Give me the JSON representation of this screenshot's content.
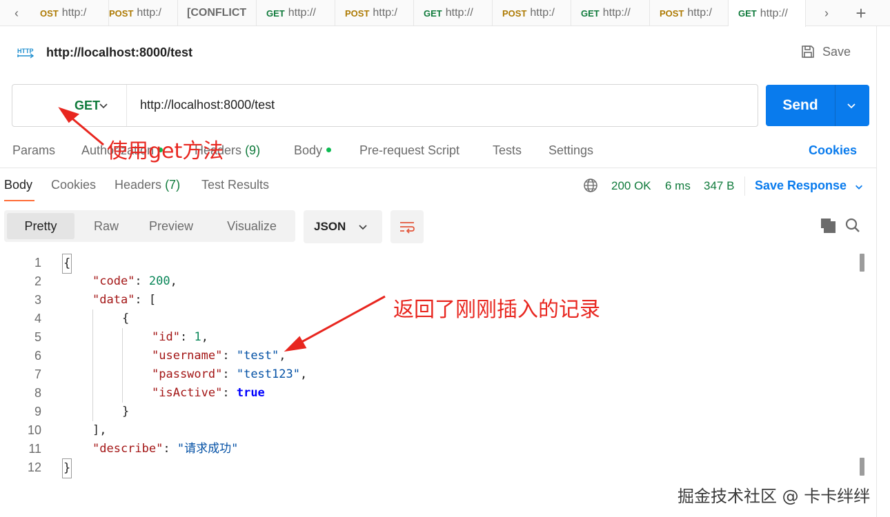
{
  "tabs": [
    {
      "method": "OST",
      "url": "http:/"
    },
    {
      "method": "POST",
      "url": "http:/"
    },
    {
      "method": "",
      "url": "[CONFLICT"
    },
    {
      "method": "GET",
      "url": "http://"
    },
    {
      "method": "POST",
      "url": "http:/"
    },
    {
      "method": "GET",
      "url": "http://"
    },
    {
      "method": "POST",
      "url": "http:/"
    },
    {
      "method": "GET",
      "url": "http://"
    },
    {
      "method": "POST",
      "url": "http:/"
    },
    {
      "method": "GET",
      "url": "http://"
    }
  ],
  "request": {
    "title": "http://localhost:8000/test",
    "save_label": "Save",
    "method": "GET",
    "url": "http://localhost:8000/test",
    "send_label": "Send"
  },
  "request_tabs": {
    "params": "Params",
    "authorization": "Authorization",
    "headers": "Headers",
    "headers_count": "(9)",
    "body": "Body",
    "prerequest": "Pre-request Script",
    "tests": "Tests",
    "settings": "Settings",
    "cookies": "Cookies"
  },
  "response_tabs": {
    "body": "Body",
    "cookies": "Cookies",
    "headers": "Headers",
    "headers_count": "(7)",
    "test_results": "Test Results"
  },
  "response_status": {
    "status": "200 OK",
    "time": "6 ms",
    "size": "347 B",
    "save_response": "Save Response"
  },
  "view_modes": [
    "Pretty",
    "Raw",
    "Preview",
    "Visualize"
  ],
  "format": "JSON",
  "code": {
    "line_numbers": [
      "1",
      "2",
      "3",
      "4",
      "5",
      "6",
      "7",
      "8",
      "9",
      "10",
      "11",
      "12"
    ],
    "open_brace": "{",
    "k_code": "\"code\"",
    "v_code": "200",
    "k_data": "\"data\"",
    "open_bracket": "[",
    "obj_open": "{",
    "k_id": "\"id\"",
    "v_id": "1",
    "k_username": "\"username\"",
    "v_username": "\"test\"",
    "k_password": "\"password\"",
    "v_password": "\"test123\"",
    "k_isactive": "\"isActive\"",
    "v_isactive": "true",
    "obj_close": "}",
    "close_bracket": "],",
    "k_describe": "\"describe\"",
    "v_describe": "\"请求成功\"",
    "close_brace": "}"
  },
  "annotations": {
    "get_method": "使用get方法",
    "returned": "返回了刚刚插入的记录"
  },
  "watermark": "掘金技术社区 @ 卡卡绊绊",
  "colors": {
    "accent_blue": "#097bed",
    "get_green": "#0f7a3b",
    "post_orange": "#ad7a03",
    "annotation_red": "#e8261f",
    "tab_underline": "#ff6c37"
  },
  "icons": {
    "http": "http-request-icon",
    "save": "floppy-disk-icon",
    "globe": "globe-icon",
    "wrap": "text-wrap-icon",
    "copy": "copy-icon",
    "search": "search-icon"
  }
}
